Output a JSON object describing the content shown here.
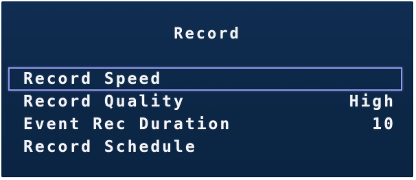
{
  "screen": {
    "title": "Record"
  },
  "menu": {
    "items": [
      {
        "label": "Record Speed",
        "value": ""
      },
      {
        "label": "Record Quality",
        "value": "High"
      },
      {
        "label": "Event Rec Duration",
        "value": "10"
      },
      {
        "label": "Record Schedule",
        "value": ""
      }
    ],
    "selected_index": 0
  },
  "colors": {
    "background": "#0e2a4c",
    "text": "#eef1f8",
    "selection_border": "#8b8fe0"
  }
}
